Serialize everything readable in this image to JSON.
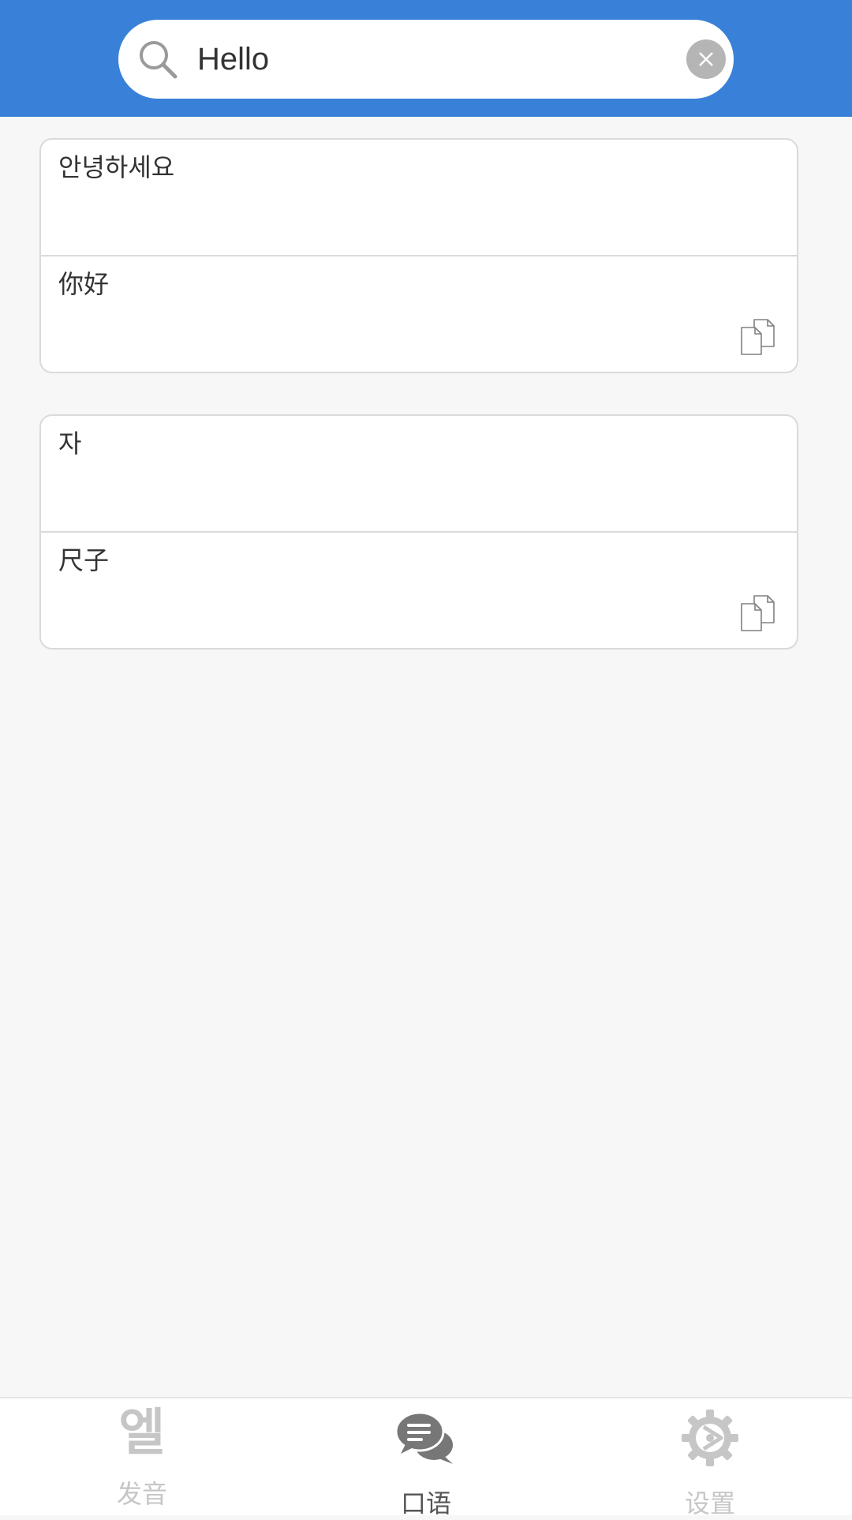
{
  "search": {
    "value": "Hello",
    "icon": "search-icon",
    "clear_icon": "close-icon"
  },
  "results": [
    {
      "korean": "안녕하세요",
      "chinese": "你好",
      "copy_icon": "copy-icon"
    },
    {
      "korean": "자",
      "chinese": "尺子",
      "copy_icon": "copy-icon"
    }
  ],
  "tabbar": {
    "tabs": [
      {
        "label": "发音",
        "icon_glyph": "엘",
        "icon": "korean-letter-icon",
        "active": false
      },
      {
        "label": "口语",
        "icon": "chat-bubbles-icon",
        "active": true
      },
      {
        "label": "设置",
        "icon": "gear-icon",
        "active": false
      }
    ]
  },
  "colors": {
    "header": "#3981d8",
    "background": "#f7f7f7",
    "tab_active": "#555555",
    "tab_inactive": "#c6c6c6"
  }
}
